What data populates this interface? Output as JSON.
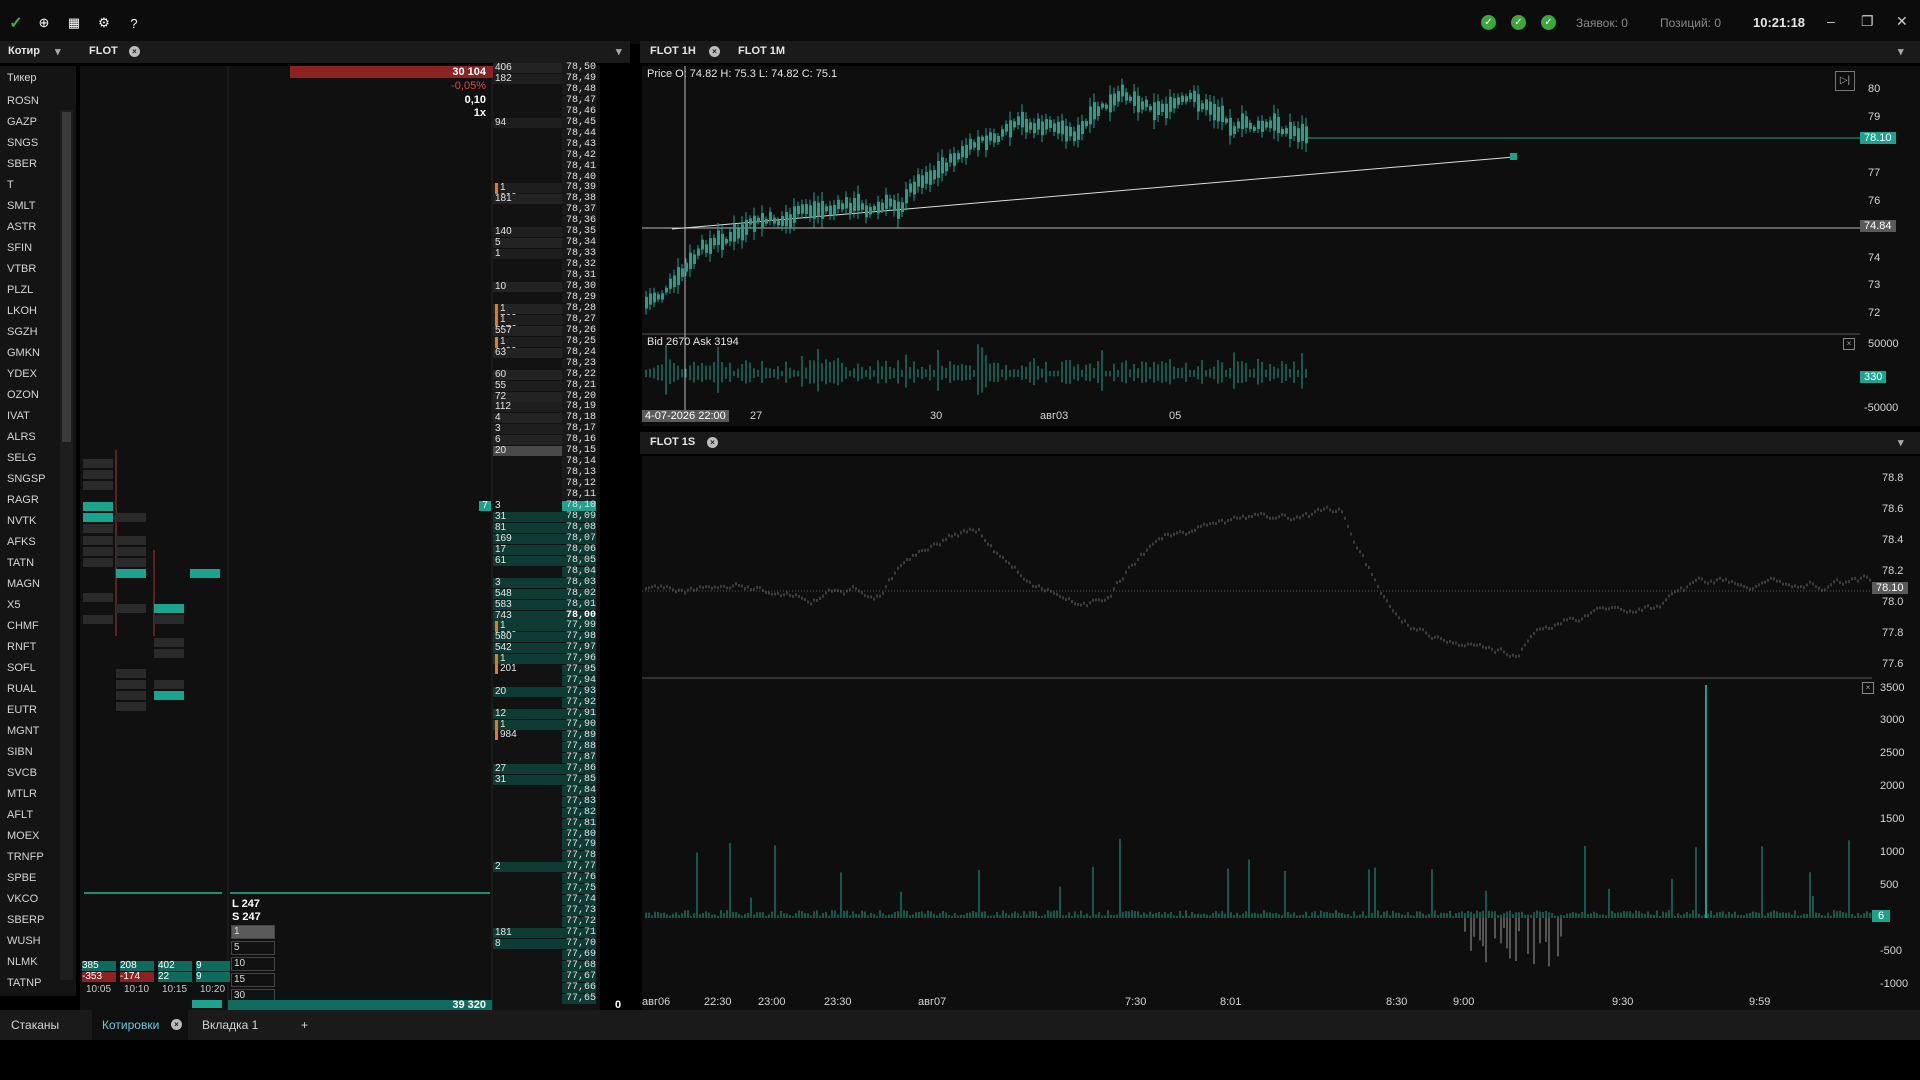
{
  "topbar": {
    "status_orders": "Заявок: 0",
    "status_positions": "Позиций: 0",
    "clock": "10:21:18"
  },
  "left_panel": {
    "header": "Котир",
    "column_header": "Тикер",
    "tickers": [
      "ROSN",
      "GAZP",
      "SNGS",
      "SBER",
      "T",
      "SMLT",
      "ASTR",
      "SFIN",
      "VTBR",
      "PLZL",
      "LKOH",
      "SGZH",
      "GMKN",
      "YDEX",
      "OZON",
      "IVAT",
      "ALRS",
      "SELG",
      "SNGSP",
      "RAGR",
      "NVTK",
      "AFKS",
      "TATN",
      "MAGN",
      "X5",
      "CHMF",
      "RNFT",
      "SOFL",
      "RUAL",
      "EUTR",
      "MGNT",
      "SIBN",
      "SVCB",
      "MTLR",
      "AFLT",
      "MOEX",
      "TRNFP",
      "SPBE",
      "VKCO",
      "SBERP",
      "WUSH",
      "NLMK",
      "TATNP"
    ]
  },
  "book": {
    "tab": "FLOT",
    "top_volume": "30 104",
    "change_pct": "-0,05%",
    "step": "0,10",
    "multiplier": "1x",
    "bottom_volume": "39 320",
    "ls_L": "L 247",
    "ls_S": "S 247",
    "lot_sizes": [
      "1",
      "5",
      "10",
      "15",
      "30"
    ],
    "times": [
      "10:05",
      "10:10",
      "10:15",
      "10:20"
    ],
    "bottom_cells_top": [
      "385",
      "208",
      "402",
      "9"
    ],
    "bottom_cells_bot": [
      "-353",
      "-174",
      "22",
      "9"
    ],
    "ladder_zero": "0",
    "ladder_prices": [
      "78,50",
      "78,49",
      "78,48",
      "78,47",
      "78,46",
      "78,45",
      "78,44",
      "78,43",
      "78,42",
      "78,41",
      "78,40",
      "78,39",
      "78,38",
      "78,37",
      "78,36",
      "78,35",
      "78,34",
      "78,33",
      "78,32",
      "78,31",
      "78,30",
      "78,29",
      "78,28",
      "78,27",
      "78,26",
      "78,25",
      "78,24",
      "78,23",
      "78,22",
      "78,21",
      "78,20",
      "78,19",
      "78,18",
      "78,17",
      "78,16",
      "78,15",
      "78,14",
      "78,13",
      "78,12",
      "78,11",
      "78,10",
      "78,09",
      "78,08",
      "78,07",
      "78,06",
      "78,05",
      "78,04",
      "78,03",
      "78,02",
      "78,01",
      "78,00",
      "77,99",
      "77,98",
      "77,97",
      "77,96",
      "77,95",
      "77,94",
      "77,93",
      "77,92",
      "77,91",
      "77,90",
      "77,89",
      "77,88",
      "77,87",
      "77,86",
      "77,85",
      "77,84",
      "77,83",
      "77,82",
      "77,81",
      "77,80",
      "77,79",
      "77,78",
      "77,77",
      "77,76",
      "77,75",
      "77,74",
      "77,73",
      "77,72",
      "77,71",
      "77,70",
      "77,69",
      "77,68",
      "77,67",
      "77,66",
      "77,65"
    ],
    "ladder_vols": [
      "406",
      "182",
      "",
      "",
      "",
      "94",
      "",
      "",
      "",
      "",
      "",
      "1 000",
      "181",
      "",
      "",
      "140",
      "5",
      "1",
      "",
      "",
      "10",
      "",
      "1 760",
      "1 176",
      "557",
      "1 439",
      "63",
      "",
      "60",
      "55",
      "72",
      "112",
      "4",
      "3",
      "6",
      "20",
      "",
      "",
      "",
      "",
      "3",
      "31",
      "81",
      "169",
      "17",
      "61",
      "",
      "3",
      "548",
      "583",
      "743",
      "1 360",
      "580",
      "542",
      "1 201",
      "",
      "",
      "20",
      "",
      "12",
      "1 984",
      "",
      "",
      "",
      "27",
      "31",
      "",
      "",
      "",
      "",
      "",
      "",
      "",
      "2",
      "",
      "",
      "",
      "",
      "",
      "181",
      "8",
      "",
      "",
      "",
      "",
      ""
    ],
    "last_price_label": "7"
  },
  "chart1h": {
    "tabs": [
      "FLOT 1H",
      "FLOT 1M"
    ],
    "ohlc": "Price O: 74.82 H: 75.3 L: 74.82 C: 75.1",
    "volume_label": "Bid 2670 Ask 3194",
    "crosshair_date": "4-07-2026 22:00",
    "price_axis": [
      "80",
      "79",
      "77",
      "76",
      "74",
      "73",
      "72"
    ],
    "current_price": "78.10",
    "cursor_price": "74.84",
    "vol_axis": [
      "50000",
      "-50000"
    ],
    "vol_current": "330",
    "x_labels": [
      "27",
      "30",
      "авг03",
      "05"
    ]
  },
  "chart1s": {
    "tab": "FLOT 1S",
    "price_axis": [
      "78.8",
      "78.6",
      "78.4",
      "78.2",
      "78.0",
      "77.8",
      "77.6"
    ],
    "current_price": "78.10",
    "vol_axis": [
      "3500",
      "3000",
      "2500",
      "2000",
      "1500",
      "1000",
      "500",
      "-500",
      "-1000"
    ],
    "vol_current": "6",
    "x_labels": [
      "авг06",
      "22:30",
      "23:00",
      "23:30",
      "авг07",
      "7:30",
      "8:01",
      "8:30",
      "9:00",
      "9:30",
      "9:59"
    ]
  },
  "bottom_tabs": [
    "Стаканы",
    "Котировки",
    "Вкладка 1",
    "+"
  ]
}
